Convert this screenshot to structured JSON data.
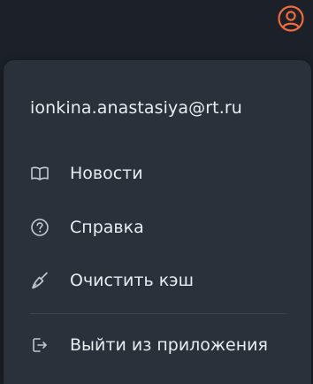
{
  "colors": {
    "background": "#1c2129",
    "menu_background": "#2a313b",
    "text": "#e9ecf0",
    "icon": "#c3c8cf",
    "accent": "#f06a3c",
    "divider": "#3b434e"
  },
  "header": {
    "account_icon": "user-circle-icon"
  },
  "menu": {
    "email": "ionkina.anastasiya@rt.ru",
    "items": [
      {
        "icon": "book-open-icon",
        "label": "Новости"
      },
      {
        "icon": "question-circle-icon",
        "label": "Справка"
      },
      {
        "icon": "broom-icon",
        "label": "Очистить кэш"
      },
      {
        "icon": "logout-icon",
        "label": "Выйти из приложения"
      }
    ]
  }
}
